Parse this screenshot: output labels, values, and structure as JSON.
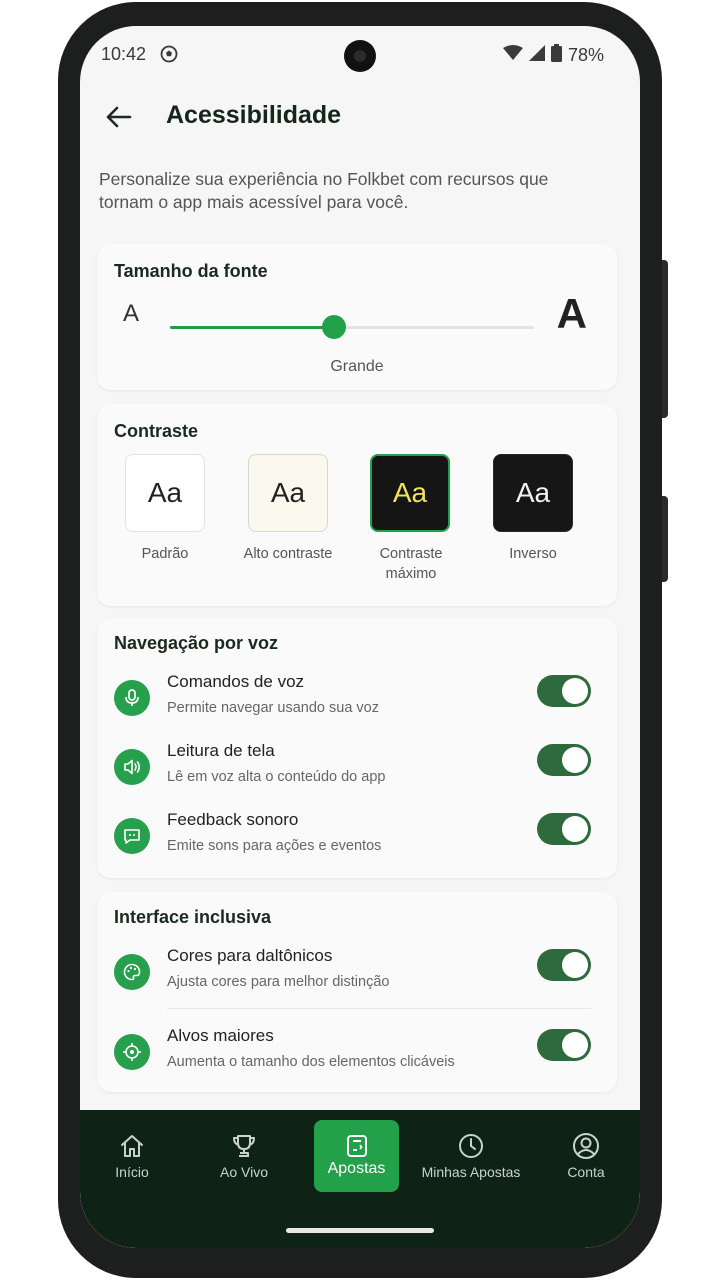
{
  "status_bar": {
    "time": "10:42",
    "battery": "78%"
  },
  "header": {
    "title": "Acessibilidade"
  },
  "intro": "Personalize sua experiência no Folkbet com recursos que tornam o app mais acessível para você.",
  "font_size": {
    "title": "Tamanho da fonte",
    "small_glyph": "A",
    "large_glyph": "A",
    "value_label": "Grande",
    "level": 0.45
  },
  "contrast": {
    "title": "Contraste",
    "sample": "Aa",
    "options": [
      {
        "label": "Padrão"
      },
      {
        "label": "Alto contraste"
      },
      {
        "label": "Contraste máximo",
        "selected": true
      },
      {
        "label": "Inverso"
      }
    ]
  },
  "voice": {
    "title": "Navegação por voz",
    "items": [
      {
        "title": "Comandos de voz",
        "subtitle": "Permite navegar usando sua voz",
        "icon": "microphone-icon",
        "on": true
      },
      {
        "title": "Leitura de tela",
        "subtitle": "Lê em voz alta o conteúdo do app",
        "icon": "speaker-icon",
        "on": true
      },
      {
        "title": "Feedback sonoro",
        "subtitle": "Emite sons para ações e eventos",
        "icon": "message-icon",
        "on": true
      }
    ]
  },
  "inclusive": {
    "title": "Interface inclusiva",
    "items": [
      {
        "title": "Cores para daltônicos",
        "subtitle": "Ajusta cores para melhor distinção",
        "icon": "palette-icon",
        "on": true
      },
      {
        "title": "Alvos maiores",
        "subtitle": "Aumenta o tamanho dos elementos clicáveis",
        "icon": "target-icon",
        "on": true
      }
    ]
  },
  "bottom_nav": {
    "items": [
      {
        "label": "Início",
        "icon": "home-icon"
      },
      {
        "label": "Ao Vivo",
        "icon": "trophy-icon"
      },
      {
        "label": "Apostas",
        "icon": "ticket-icon",
        "active": true
      },
      {
        "label": "Minhas Apostas",
        "icon": "clock-icon"
      },
      {
        "label": "Conta",
        "icon": "user-icon"
      }
    ]
  },
  "colors": {
    "accent": "#22a14a",
    "toggle_on": "#2e6b3c",
    "nav_bg": "#0f2216",
    "highlight_text": "#f2e35a"
  }
}
